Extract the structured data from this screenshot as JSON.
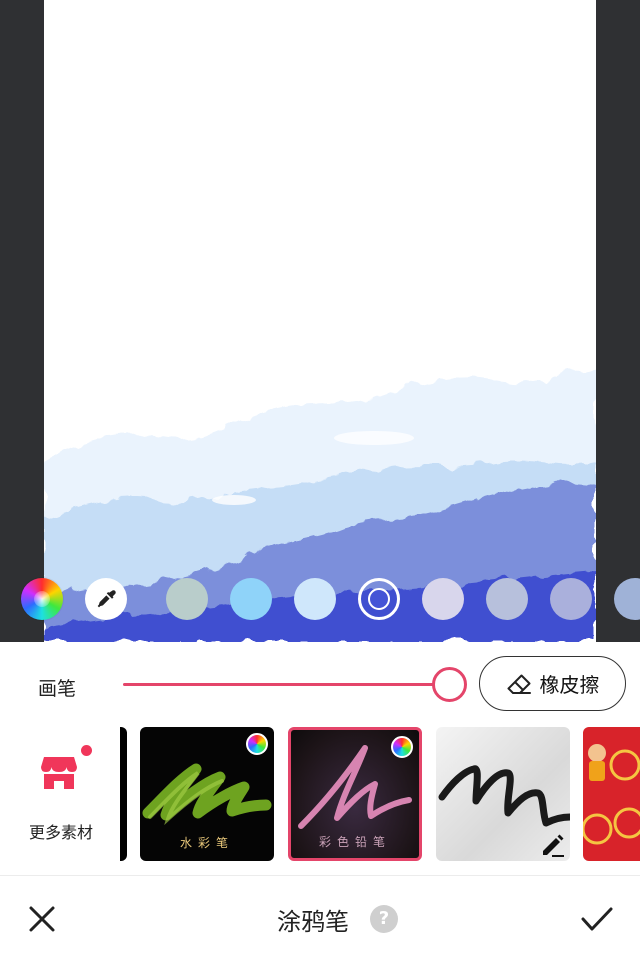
{
  "canvas": {
    "background": "#2f3033",
    "paper": "#ffffff",
    "wash_colors": [
      "#eaf3fd",
      "#c5ddf6",
      "#7b8fdb",
      "#3f4fd0"
    ]
  },
  "palette": {
    "selected_color": "#4454d6",
    "swatches": [
      "#b9cdcb",
      "#8fd3f9",
      "#cfe7fb",
      "#d8d6ec",
      "#b7c0dc",
      "#aab0dc",
      "#9fb2d7"
    ]
  },
  "brush": {
    "label": "画笔",
    "size_percent": 100,
    "accent_color": "#e4456a",
    "eraser_label": "橡皮擦"
  },
  "materials": {
    "more_label": "更多素材",
    "tiles": [
      {
        "caption": "水彩笔",
        "stroke_color": "#7ab523",
        "has_color_wheel": true,
        "selected": false
      },
      {
        "caption": "彩色铅笔",
        "stroke_color": "#e08ab8",
        "has_color_wheel": true,
        "selected": true
      },
      {
        "caption": "",
        "stroke_color": "#1a1a1a",
        "has_color_wheel": false,
        "selected": false
      },
      {
        "caption": "",
        "stroke_color": "#f5c542",
        "has_color_wheel": false,
        "selected": false
      }
    ]
  },
  "footer": {
    "title": "涂鸦笔",
    "help_glyph": "?"
  }
}
